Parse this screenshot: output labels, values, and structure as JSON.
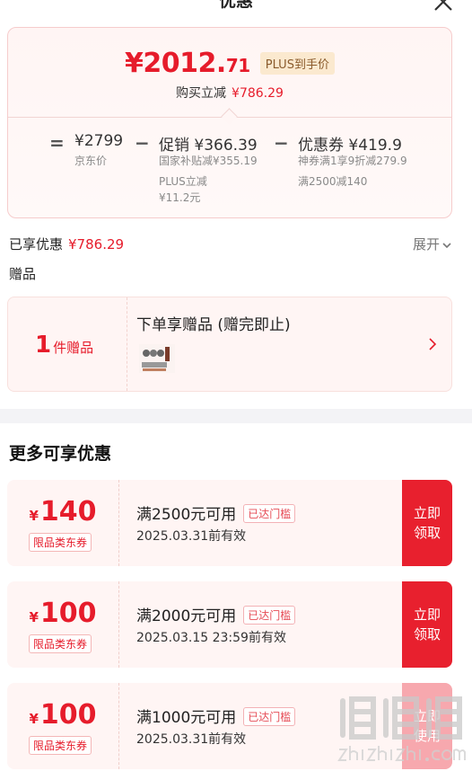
{
  "header": {
    "title": "优惠"
  },
  "price_card": {
    "final_price_int": "¥2012.",
    "final_price_dec": "71",
    "plus_tag": "PLUS到手价",
    "save_label": "购买立减",
    "save_amount": "¥786.29",
    "breakdown": {
      "eq": "=",
      "jd_price": "¥2799",
      "jd_price_label": "京东价",
      "minus1": "−",
      "promo": "促销 ¥366.39",
      "promo_sub1": "国家补贴减¥355.19",
      "promo_sub2": "PLUS立减",
      "promo_sub3": "¥11.2元",
      "minus2": "−",
      "coupon": "优惠券 ¥419.9",
      "coupon_sub1": "神券满1享9折减279.9",
      "coupon_sub2": "满2500减140"
    }
  },
  "enjoyed": {
    "label": "已享优惠",
    "amount": "¥786.29",
    "expand": "展开"
  },
  "gifts": {
    "section_title": "赠品",
    "count": "1",
    "count_unit": "件赠品",
    "title": "下单享赠品 (赠完即止)"
  },
  "more": {
    "title": "更多可享优惠",
    "coupons": [
      {
        "currency": "¥",
        "value": "140",
        "tag": "限品类东券",
        "condition": "满2500元可用",
        "badge": "已达门槛",
        "expiry": "2025.03.31前有效",
        "button": "立即领取"
      },
      {
        "currency": "¥",
        "value": "100",
        "tag": "限品类东券",
        "condition": "满2000元可用",
        "badge": "已达门槛",
        "expiry": "2025.03.15 23:59前有效",
        "button": "立即领取"
      },
      {
        "currency": "¥",
        "value": "100",
        "tag": "限品类东券",
        "condition": "满1000元可用",
        "badge": "已达门槛",
        "expiry": "2025.03.31前有效",
        "button": "立即使用"
      }
    ]
  },
  "watermark": {
    "brand": "值值值",
    "domain": "zhizhizhi.com"
  },
  "colors": {
    "accent": "#e61c2b",
    "button": "#e8202e",
    "card_bg": "#fff5f4",
    "plus_tag_bg": "#fbe9cf"
  }
}
